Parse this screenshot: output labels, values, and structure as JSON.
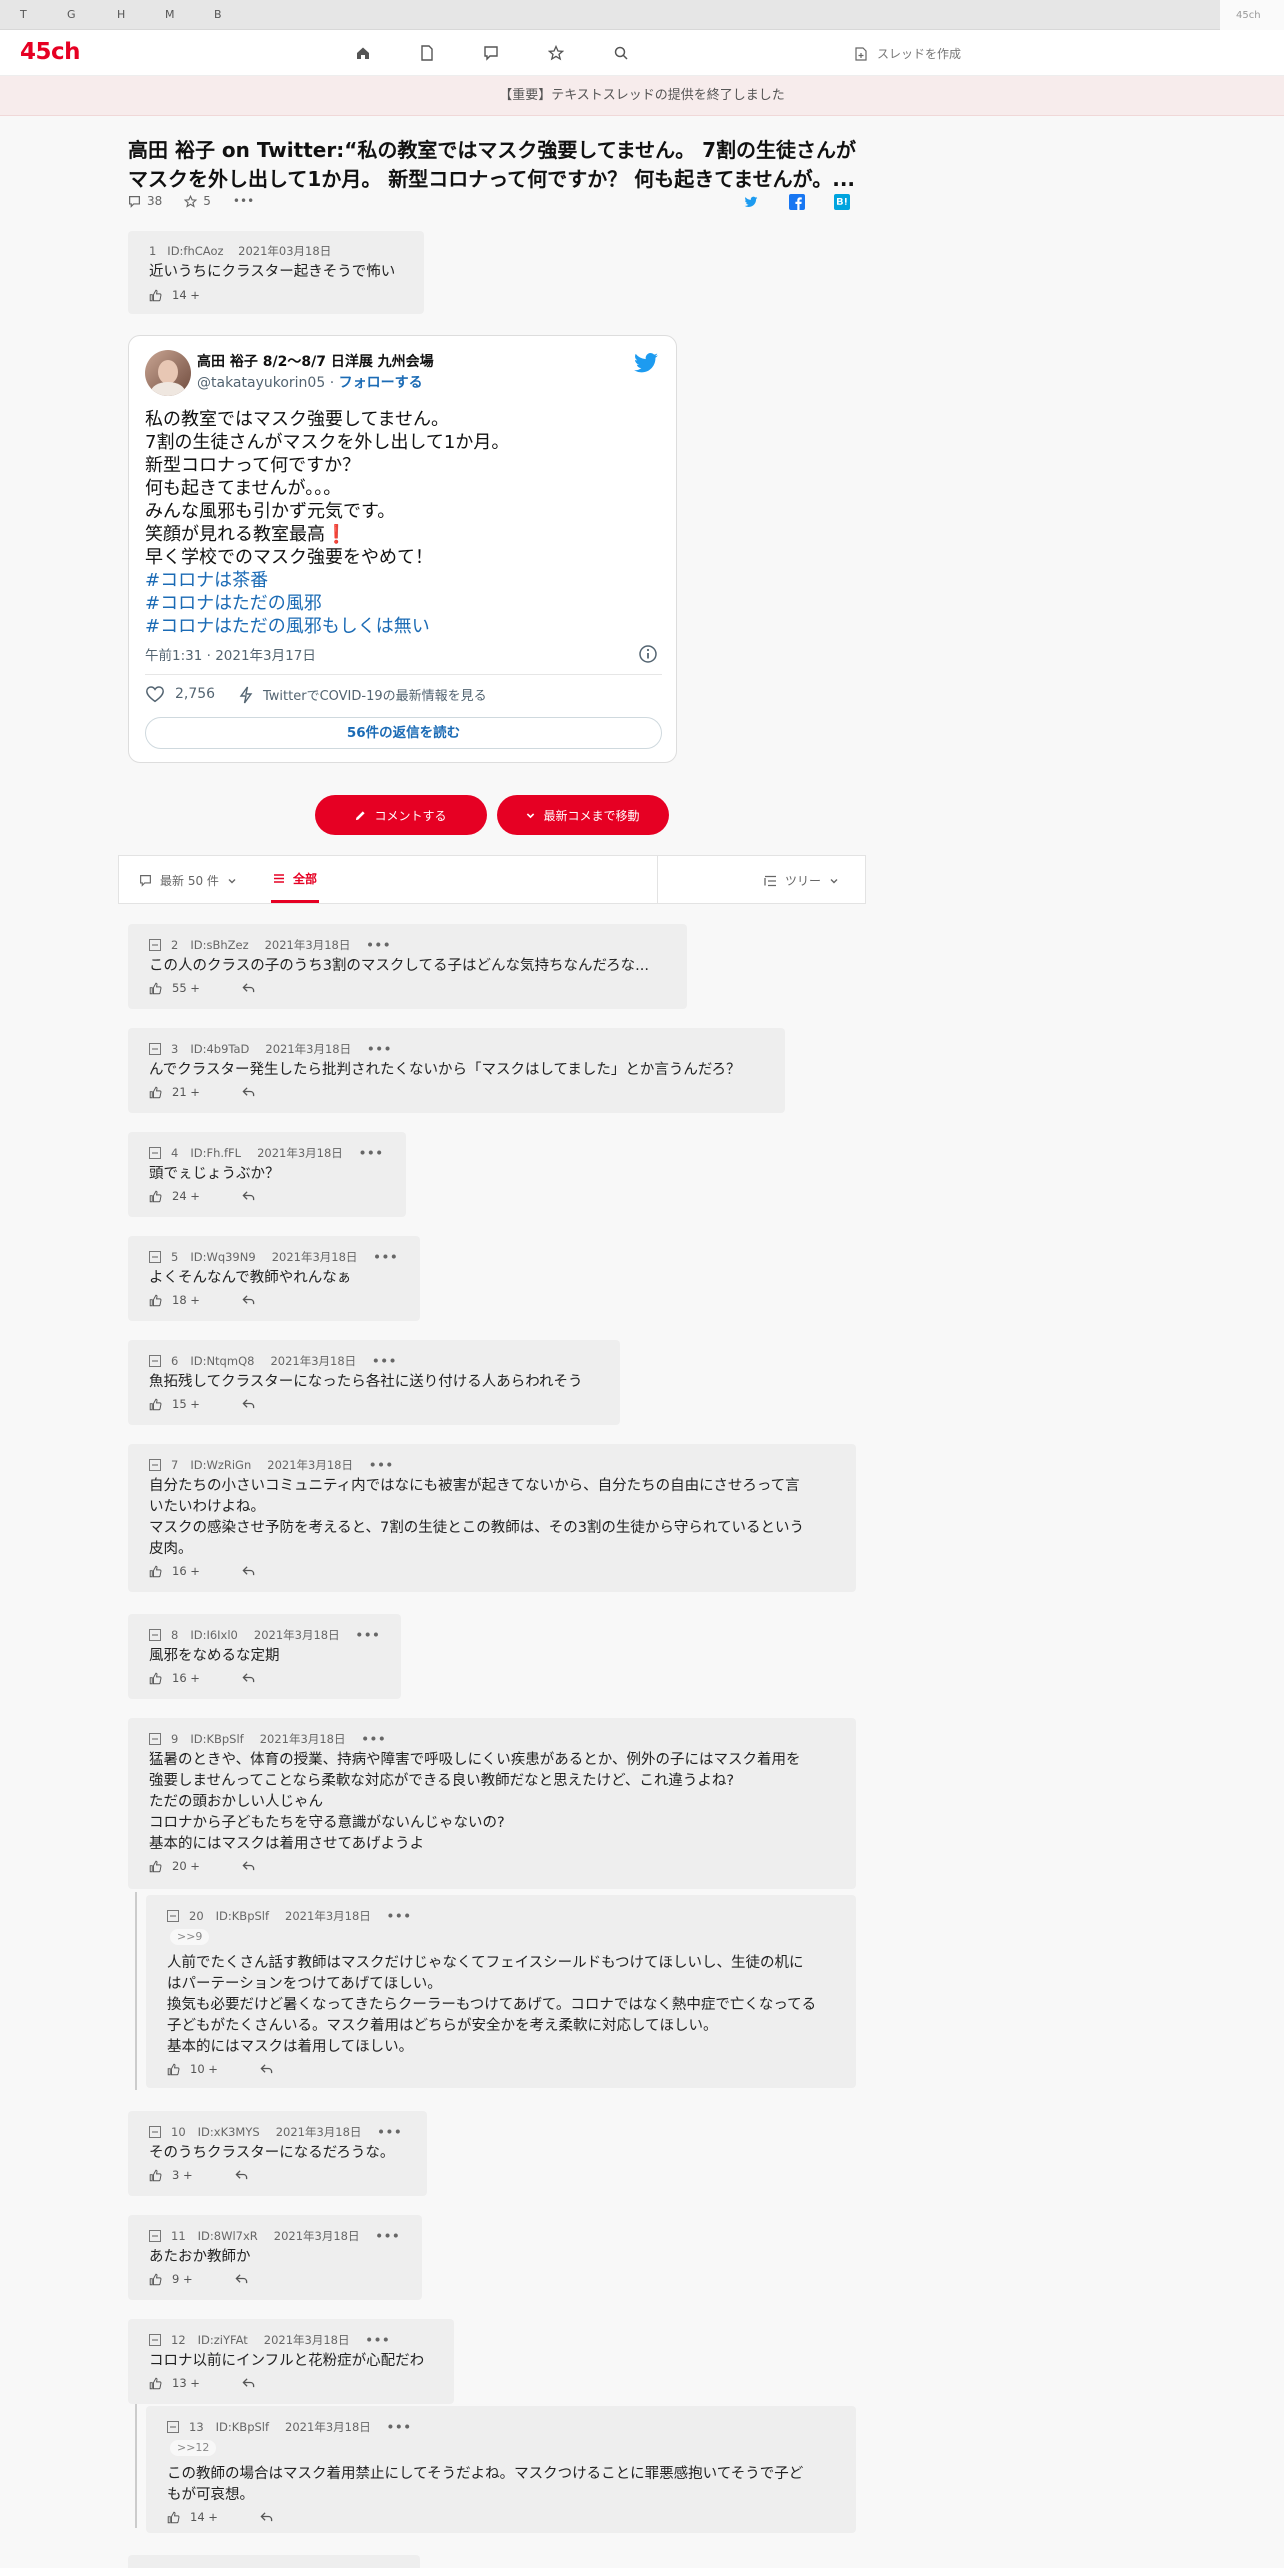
{
  "browser": {
    "bookmarks": [
      "T",
      "G",
      "H",
      "M",
      "B"
    ],
    "tab": "45ch"
  },
  "header": {
    "logo": "45ch",
    "create_label": "スレッドを作成"
  },
  "notice": "【重要】テキストスレッドの提供を終了しました",
  "thread": {
    "title": "高田 裕子 on Twitter:“私の教室ではマスク強要してません。 7割の生徒さんがマスクを外し出して1か月。 新型コロナって何ですか？ 何も起きてませんが。...",
    "comments": "38",
    "favorites": "5",
    "more": "•••"
  },
  "first_post": {
    "num": "1",
    "id": "ID:fhCAoz",
    "date": "2021年03月18日",
    "text": "近いうちにクラスター起きそうで怖い",
    "likes": "14 +"
  },
  "tweet": {
    "name": "高田 裕子 8/2〜8/7 日洋展 九州会場",
    "handle": "@takatayukorin05 ·",
    "follow": "フォローする",
    "lines": [
      "私の教室ではマスク強要してません。",
      "7割の生徒さんがマスクを外し出して1か月。",
      "新型コロナって何ですか？",
      "何も起きてませんが。。。",
      "みんな風邪も引かず元気です。",
      "笑顔が見れる教室最高❗",
      "早く学校でのマスク強要をやめて！"
    ],
    "hashtags": [
      "#コロナは茶番",
      "#コロナはただの風邪",
      "#コロナはただの風邪もしくは無い"
    ],
    "time": "午前1:31 · 2021年3月17日",
    "likes": "2,756",
    "covid": "TwitterでCOVID-19の最新情報を見る",
    "replies": "56件の返信を読む"
  },
  "buttons": {
    "comment": "コメントする",
    "latest": "最新コメまで移動"
  },
  "tabs": {
    "recent": "最新 50 件",
    "all": "全部",
    "tree": "ツリー"
  },
  "colors": {
    "brand": "#e60023",
    "twitter": "#1d9bf0",
    "link": "#1b6bb5"
  },
  "posts": [
    {
      "num": "2",
      "id": "ID:sBhZez",
      "date": "2021年3月18日",
      "lines": [
        "この人のクラスの子のうち3割のマスクしてる子はどんな気持ちなんだろな..."
      ],
      "likes": "55 +"
    },
    {
      "num": "3",
      "id": "ID:4b9TaD",
      "date": "2021年3月18日",
      "lines": [
        "んでクラスター発生したら批判されたくないから「マスクはしてました」とか言うんだろ？"
      ],
      "likes": "21 +"
    },
    {
      "num": "4",
      "id": "ID:Fh.fFL",
      "date": "2021年3月18日",
      "lines": [
        "頭でぇじょうぶか？"
      ],
      "likes": "24 +"
    },
    {
      "num": "5",
      "id": "ID:Wq39N9",
      "date": "2021年3月18日",
      "lines": [
        "よくそんなんで教師やれんなぁ"
      ],
      "likes": "18 +"
    },
    {
      "num": "6",
      "id": "ID:NtqmQ8",
      "date": "2021年3月18日",
      "lines": [
        "魚拓残してクラスターになったら各社に送り付ける人あらわれそう"
      ],
      "likes": "15 +"
    },
    {
      "num": "7",
      "id": "ID:WzRiGn",
      "date": "2021年3月18日",
      "lines": [
        "自分たちの小さいコミュニティ内ではなにも被害が起きてないから、自分たちの自由にさせろって言",
        "いたいわけよね。",
        "マスクの感染させ予防を考えると、7割の生徒とこの教師は、その3割の生徒から守られているという",
        "皮肉。"
      ],
      "likes": "16 +"
    },
    {
      "num": "8",
      "id": "ID:I6Ixl0",
      "date": "2021年3月18日",
      "lines": [
        "風邪をなめるな定期"
      ],
      "likes": "16 +"
    },
    {
      "num": "9",
      "id": "ID:KBpSlf",
      "date": "2021年3月18日",
      "lines": [
        "猛暑のときや、体育の授業、持病や障害で呼吸しにくい疾患があるとか、例外の子にはマスク着用を",
        "強要しませんってことなら柔軟な対応ができる良い教師だなと思えたけど、これ違うよね?",
        "ただの頭おかしい人じゃん",
        "コロナから子どもたちを守る意識がないんじゃないの?",
        "基本的にはマスクは着用させてあげようよ"
      ],
      "likes": "20 +"
    },
    {
      "num": "20",
      "id": "ID:KBpSlf",
      "date": "2021年3月18日",
      "quote": ">>9",
      "lines": [
        "人前でたくさん話す教師はマスクだけじゃなくてフェイスシールドもつけてほしいし、生徒の机に",
        "はパーテーションをつけてあげてほしい。",
        "換気も必要だけど暑くなってきたらクーラーもつけてあげて。コロナではなく熱中症で亡くなってる",
        "子どもがたくさんいる。マスク着用はどちらが安全かを考え柔軟に対応してほしい。",
        "基本的にはマスクは着用してほしい。"
      ],
      "likes": "10 +"
    },
    {
      "num": "10",
      "id": "ID:xK3MYS",
      "date": "2021年3月18日",
      "lines": [
        "そのうちクラスターになるだろうな。"
      ],
      "likes": "3 +"
    },
    {
      "num": "11",
      "id": "ID:8Wl7xR",
      "date": "2021年3月18日",
      "lines": [
        "あたおか教師か"
      ],
      "likes": "9 +"
    },
    {
      "num": "12",
      "id": "ID:ziYFAt",
      "date": "2021年3月18日",
      "lines": [
        "コロナ以前にインフルと花粉症が心配だわ"
      ],
      "likes": "13 +"
    },
    {
      "num": "13",
      "id": "ID:KBpSlf",
      "date": "2021年3月18日",
      "quote": ">>12",
      "lines": [
        "この教師の場合はマスク着用禁止にしてそうだよね。マスクつけることに罪悪感抱いてそうで子ど",
        "もが可哀想。"
      ],
      "likes": "14 +"
    }
  ]
}
